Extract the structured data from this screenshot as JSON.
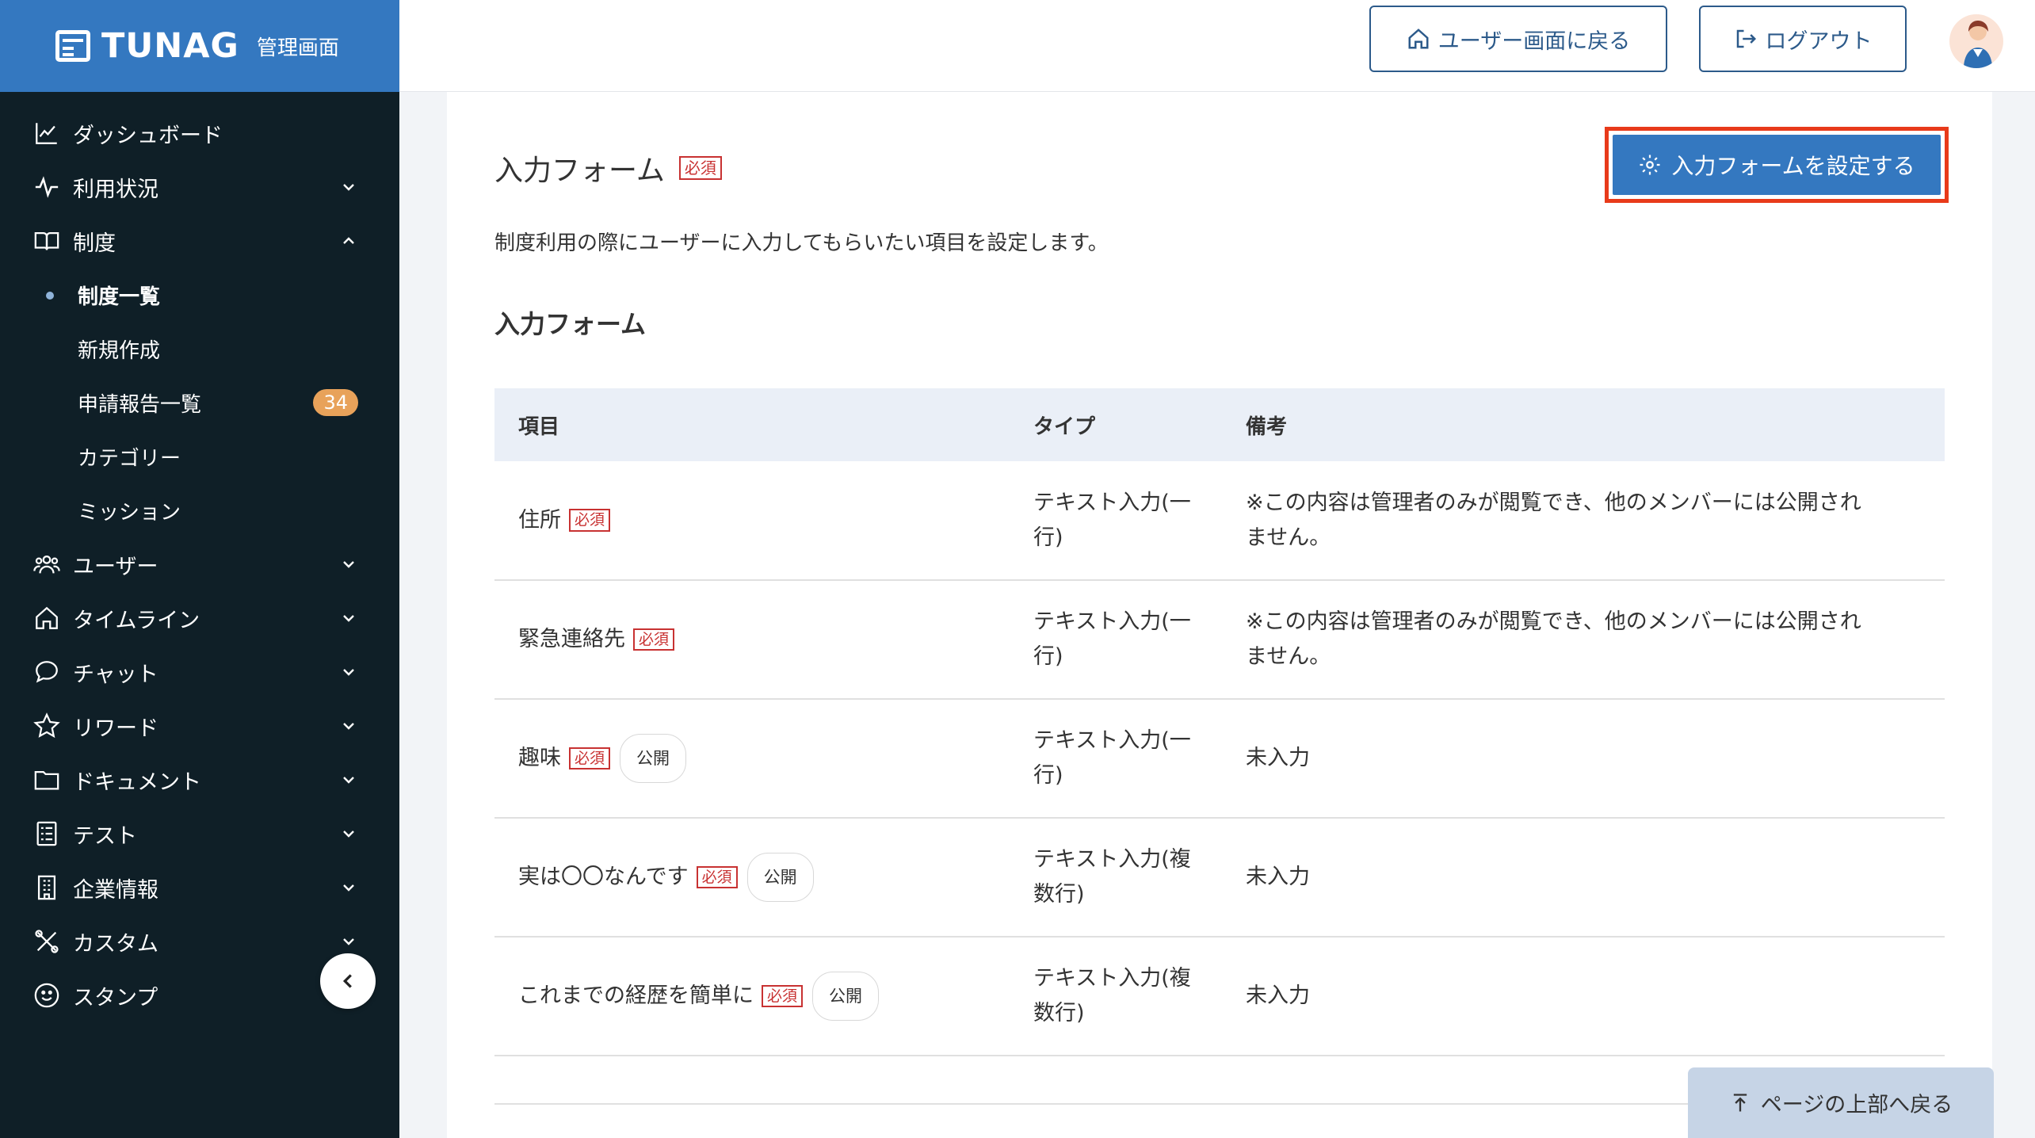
{
  "brand": {
    "name": "TUNAG",
    "subtitle": "管理画面"
  },
  "sidebar": {
    "items": [
      {
        "label": "ダッシュボード",
        "icon": "chart-icon",
        "expandable": false
      },
      {
        "label": "利用状況",
        "icon": "activity-icon",
        "expandable": true
      },
      {
        "label": "制度",
        "icon": "book-icon",
        "expandable": true,
        "expanded": true
      },
      {
        "label": "ユーザー",
        "icon": "users-icon",
        "expandable": true
      },
      {
        "label": "タイムライン",
        "icon": "home-icon",
        "expandable": true
      },
      {
        "label": "チャット",
        "icon": "chat-icon",
        "expandable": true
      },
      {
        "label": "リワード",
        "icon": "star-icon",
        "expandable": true
      },
      {
        "label": "ドキュメント",
        "icon": "folder-icon",
        "expandable": true
      },
      {
        "label": "テスト",
        "icon": "checklist-icon",
        "expandable": true
      },
      {
        "label": "企業情報",
        "icon": "building-icon",
        "expandable": true
      },
      {
        "label": "カスタム",
        "icon": "tools-icon",
        "expandable": true
      },
      {
        "label": "スタンプ",
        "icon": "smile-icon",
        "expandable": false
      }
    ],
    "subitems": [
      {
        "label": "制度一覧",
        "active": true
      },
      {
        "label": "新規作成"
      },
      {
        "label": "申請報告一覧",
        "badge": "34"
      },
      {
        "label": "カテゴリー"
      },
      {
        "label": "ミッション"
      }
    ]
  },
  "header": {
    "user_screen_label": "ユーザー画面に戻る",
    "logout_label": "ログアウト"
  },
  "main": {
    "title": "入力フォーム",
    "required_tag": "必須",
    "configure_label": "入力フォームを設定する",
    "description": "制度利用の際にユーザーに入力してもらいたい項目を設定します。",
    "subtitle": "入力フォーム",
    "table": {
      "headers": [
        "項目",
        "タイプ",
        "備考"
      ],
      "rows": [
        {
          "item": "住所",
          "required": "必須",
          "public": "",
          "type_l1": "テキスト入力(一",
          "type_l2": "行)",
          "note": "※この内容は管理者のみが閲覧でき、他のメンバーには公開され",
          "note_l2": "ません。"
        },
        {
          "item": "緊急連絡先",
          "required": "必須",
          "public": "",
          "type_l1": "テキスト入力(一",
          "type_l2": "行)",
          "note": "※この内容は管理者のみが閲覧でき、他のメンバーには公開され",
          "note_l2": "ません。"
        },
        {
          "item": "趣味",
          "required": "必須",
          "public": "公開",
          "type_l1": "テキスト入力(一",
          "type_l2": "行)",
          "note": "未入力",
          "note_l2": ""
        },
        {
          "item": "実は〇〇なんです",
          "required": "必須",
          "public": "公開",
          "type_l1": "テキスト入力(複",
          "type_l2": "数行)",
          "note": "未入力",
          "note_l2": ""
        },
        {
          "item": "これまでの経歴を簡単に",
          "required": "必須",
          "public": "公開",
          "type_l1": "テキスト入力(複",
          "type_l2": "数行)",
          "note": "未入力",
          "note_l2": ""
        }
      ]
    }
  },
  "back_to_top_label": "ページの上部へ戻る",
  "colors": {
    "brand": "#3478c0",
    "sidebar": "#0f1f27",
    "required": "#c83232",
    "highlight": "#e83a1a",
    "badge": "#e8a25a"
  }
}
